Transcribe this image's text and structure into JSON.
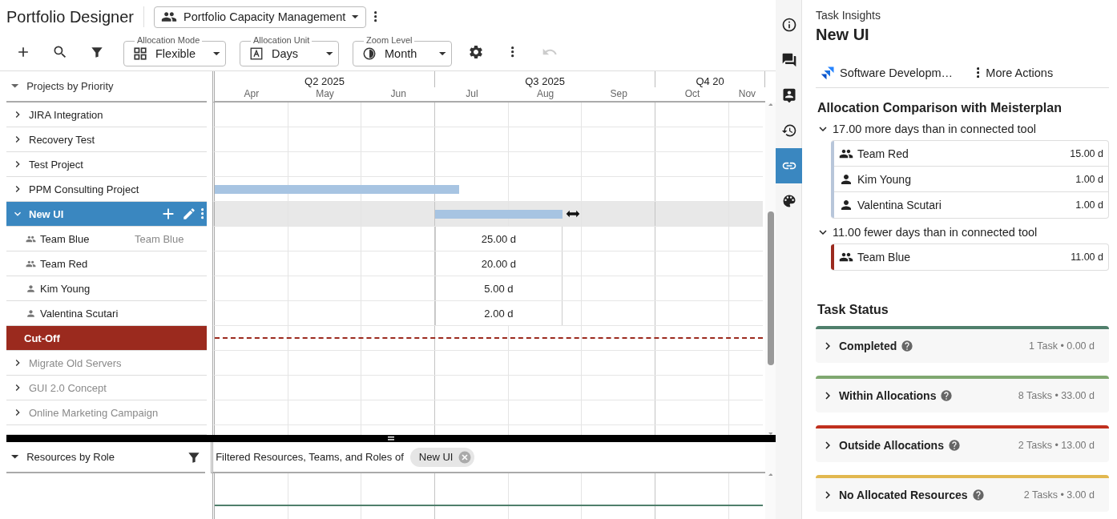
{
  "header": {
    "title": "Portfolio Designer",
    "view_selector": {
      "value": "Portfolio Capacity Management"
    }
  },
  "toolbar": {
    "selects": [
      {
        "label": "Allocation Mode",
        "value": "Flexible"
      },
      {
        "label": "Allocation Unit",
        "value": "Days"
      },
      {
        "label": "Zoom Level",
        "value": "Month"
      }
    ],
    "undo": {
      "disabled": true
    }
  },
  "timeline": {
    "quarters": [
      "Q2 2025",
      "Q3 2025",
      "Q4 20"
    ],
    "months": [
      "Apr",
      "May",
      "Jun",
      "Jul",
      "Aug",
      "Sep",
      "Oct",
      "Nov"
    ]
  },
  "projects": {
    "header": "Projects by Priority",
    "rows": [
      {
        "kind": "project",
        "label": "JIRA Integration",
        "expanded": false,
        "selected": false,
        "dimmed": false
      },
      {
        "kind": "project",
        "label": "Recovery Test",
        "expanded": false,
        "selected": false,
        "dimmed": false
      },
      {
        "kind": "project",
        "label": "Test Project",
        "expanded": false,
        "selected": false,
        "dimmed": false
      },
      {
        "kind": "project",
        "label": "PPM Consulting Project",
        "expanded": false,
        "selected": false,
        "dimmed": false,
        "bar": true
      },
      {
        "kind": "project",
        "label": "New UI",
        "expanded": true,
        "selected": true,
        "dimmed": false,
        "bar": true,
        "children": [
          {
            "kind": "team",
            "label": "Team Blue",
            "secondary": "Team Blue",
            "allocation": "25.00 d"
          },
          {
            "kind": "team",
            "label": "Team Red",
            "allocation": "20.00 d"
          },
          {
            "kind": "person",
            "label": "Kim Young",
            "allocation": "5.00 d"
          },
          {
            "kind": "person",
            "label": "Valentina Scutari",
            "allocation": "2.00 d"
          }
        ]
      },
      {
        "kind": "cutoff",
        "label": "Cut-Off"
      },
      {
        "kind": "project",
        "label": "Migrate Old Servers",
        "expanded": false,
        "selected": false,
        "dimmed": true
      },
      {
        "kind": "project",
        "label": "GUI 2.0 Concept",
        "expanded": false,
        "selected": false,
        "dimmed": true
      },
      {
        "kind": "project",
        "label": "Online Marketing Campaign",
        "expanded": false,
        "selected": false,
        "dimmed": true
      }
    ]
  },
  "resources": {
    "header": "Resources by Role",
    "filter_text": "Filtered Resources, Teams, and Roles of",
    "chip": "New UI"
  },
  "side_rail": {
    "items": [
      {
        "selected": false
      },
      {
        "selected": false
      },
      {
        "selected": false
      },
      {
        "selected": false
      },
      {
        "selected": true
      },
      {
        "selected": false
      }
    ]
  },
  "insights": {
    "title": "Task Insights",
    "task": "New UI",
    "link": "Software Developm…",
    "more_actions": "More Actions",
    "comparison": {
      "title": "Allocation Comparison with Meisterplan",
      "groups": [
        {
          "heading": "17.00 more days than in connected tool",
          "expanded": true,
          "color": "#b8c6da",
          "items": [
            {
              "kind": "team",
              "name": "Team Red",
              "value": "15.00 d"
            },
            {
              "kind": "person",
              "name": "Kim Young",
              "value": "1.00 d"
            },
            {
              "kind": "person",
              "name": "Valentina Scutari",
              "value": "1.00 d"
            }
          ]
        },
        {
          "heading": "11.00 fewer days than in connected tool",
          "expanded": true,
          "color": "#9b2a1e",
          "items": [
            {
              "kind": "team",
              "name": "Team Blue",
              "value": "11.00 d"
            }
          ]
        }
      ]
    },
    "status": {
      "title": "Task Status",
      "cards": [
        {
          "label": "Completed",
          "summary": "1 Task • 0.00 d",
          "color": "#4f7f6b",
          "expanded": false
        },
        {
          "label": "Within Allocations",
          "summary": "8 Tasks • 33.00 d",
          "color": "#7fa870",
          "expanded": false
        },
        {
          "label": "Outside Allocations",
          "summary": "2 Tasks • 13.00 d",
          "color": "#c0301e",
          "expanded": false
        },
        {
          "label": "No Allocated Resources",
          "summary": "2 Tasks • 3.00 d",
          "color": "#e2b84f",
          "expanded": false
        }
      ]
    }
  }
}
